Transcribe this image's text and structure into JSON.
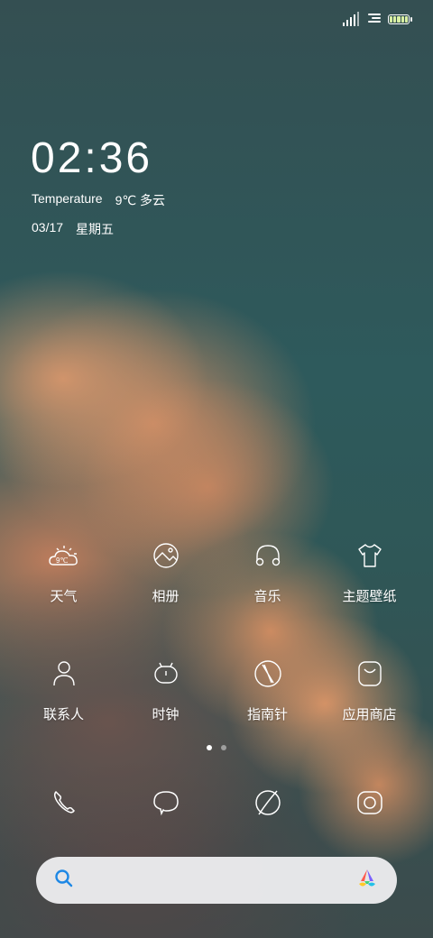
{
  "lockscreen": {
    "time": "02:36",
    "weather_label": "Temperature",
    "weather_value": "9℃ 多云",
    "date": "03/17",
    "weekday": "星期五"
  },
  "status": {
    "battery_level": 1.0,
    "battery_color": "#d9f0a3"
  },
  "apps": [
    {
      "label": "天气",
      "icon": "weather-icon"
    },
    {
      "label": "相册",
      "icon": "gallery-icon"
    },
    {
      "label": "音乐",
      "icon": "headphones-icon"
    },
    {
      "label": "主题壁纸",
      "icon": "tshirt-icon"
    },
    {
      "label": "联系人",
      "icon": "person-icon"
    },
    {
      "label": "时钟",
      "icon": "clock-icon"
    },
    {
      "label": "指南针",
      "icon": "compass-icon"
    },
    {
      "label": "应用商店",
      "icon": "store-bag-icon"
    }
  ],
  "weather_icon_text": "9℃",
  "pager": {
    "pages": 2,
    "current": 1
  },
  "dock": [
    {
      "icon": "phone-icon"
    },
    {
      "icon": "message-bubble-icon"
    },
    {
      "icon": "browser-planet-icon"
    },
    {
      "icon": "camera-icon"
    }
  ],
  "search": {
    "placeholder": ""
  }
}
